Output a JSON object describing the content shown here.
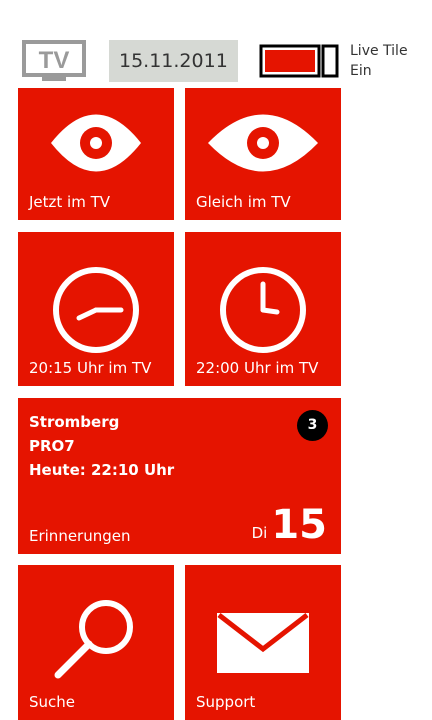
{
  "header": {
    "logo_text": "TV",
    "date": "15.11.2011",
    "live_tile_label": "Live Tile",
    "live_tile_state": "Ein"
  },
  "tiles": {
    "now": {
      "label": "Jetzt im TV",
      "icon": "eye-icon"
    },
    "soon": {
      "label": "Gleich im TV",
      "icon": "eye-icon"
    },
    "t2015": {
      "label": "20:15 Uhr im TV",
      "icon": "clock-icon"
    },
    "t2200": {
      "label": "22:00 Uhr im TV",
      "icon": "clock-icon"
    },
    "reminders": {
      "title": "Stromberg",
      "channel": "PRO7",
      "time": "Heute: 22:10 Uhr",
      "label": "Erinnerungen",
      "badge": "3",
      "day_name": "Di",
      "day_num": "15"
    },
    "search": {
      "label": "Suche",
      "icon": "magnifier-icon"
    },
    "support": {
      "label": "Support",
      "icon": "envelope-icon"
    }
  },
  "colors": {
    "tile": "#e51400",
    "date_bg": "#d6d9d4",
    "toggle_fill": "#e51400"
  }
}
